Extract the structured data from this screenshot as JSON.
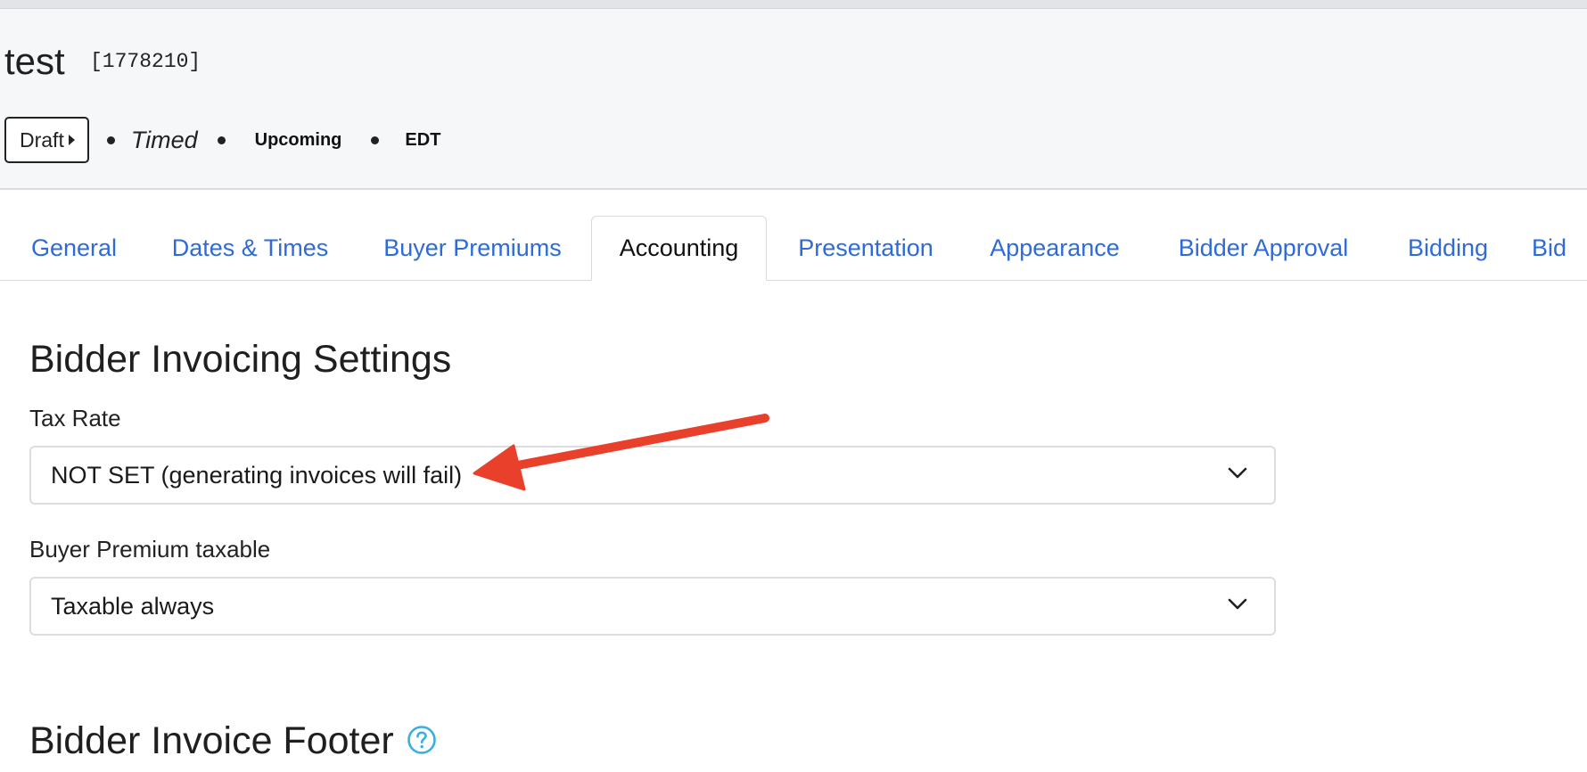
{
  "header": {
    "title": "test",
    "id_label": "[1778210]",
    "status_button": "Draft",
    "type": "Timed",
    "state": "Upcoming",
    "timezone": "EDT"
  },
  "tabs": [
    {
      "label": "General",
      "active": false
    },
    {
      "label": "Dates & Times",
      "active": false
    },
    {
      "label": "Buyer Premiums",
      "active": false
    },
    {
      "label": "Accounting",
      "active": true
    },
    {
      "label": "Presentation",
      "active": false
    },
    {
      "label": "Appearance",
      "active": false
    },
    {
      "label": "Bidder Approval",
      "active": false
    },
    {
      "label": "Bidding",
      "active": false
    },
    {
      "label": "Bid",
      "active": false
    }
  ],
  "invoicing": {
    "title": "Bidder Invoicing Settings",
    "tax_rate": {
      "label": "Tax Rate",
      "value": "NOT SET (generating invoices will fail)"
    },
    "buyer_premium_taxable": {
      "label": "Buyer Premium taxable",
      "value": "Taxable always"
    }
  },
  "footer_section": {
    "title": "Bidder Invoice Footer"
  },
  "icons": {
    "status_caret": "caret-right-icon",
    "select_chevron": "chevron-down-icon",
    "help": "question-circle-icon"
  },
  "colors": {
    "link": "#2e6bd8",
    "annotation_arrow": "#e8402a",
    "help_icon": "#3aaee0"
  }
}
